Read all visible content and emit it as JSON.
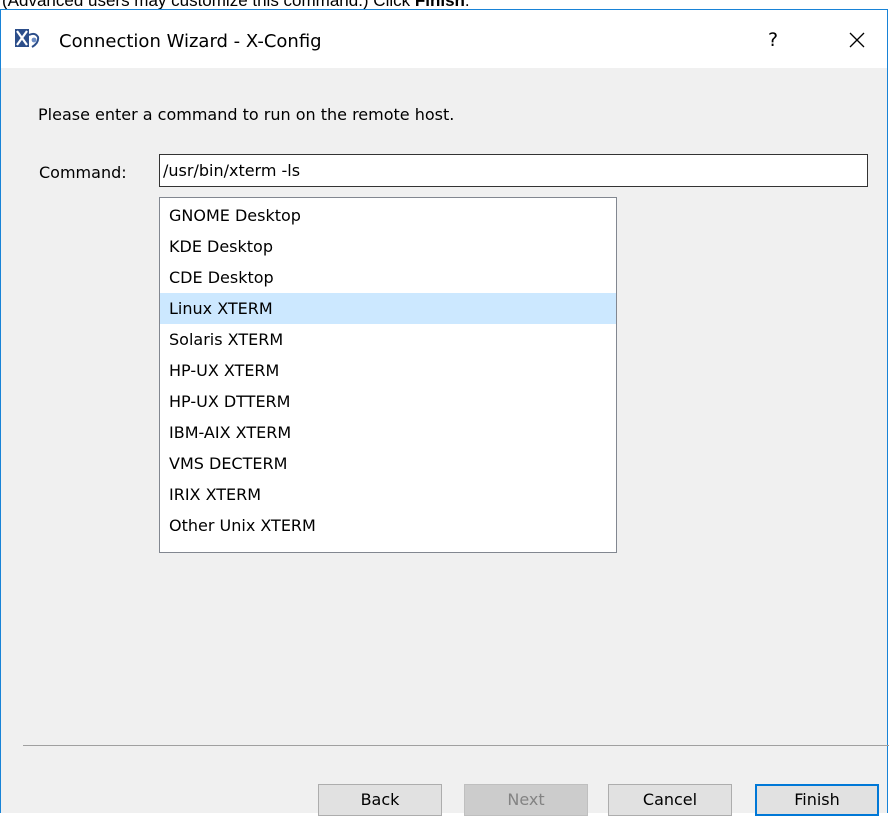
{
  "caption": {
    "text_before": "(Advanced users may customize this command.) Click ",
    "bold": "Finish",
    "text_after": "."
  },
  "window": {
    "title": "Connection Wizard - X-Config",
    "help_label": "?",
    "app_icon": "x-config-icon",
    "close_icon": "close-icon",
    "accent": "#1883d7"
  },
  "content": {
    "prompt": "Please enter a command to run on the remote host.",
    "command_label": "Command:",
    "command_value": "/usr/bin/xterm -ls"
  },
  "list": {
    "selected_index": 3,
    "selected_color": "#cce8ff",
    "items": [
      "GNOME Desktop",
      "KDE Desktop",
      "CDE Desktop",
      "Linux XTERM",
      "Solaris XTERM",
      "HP-UX XTERM",
      "HP-UX DTTERM",
      "IBM-AIX XTERM",
      "VMS DECTERM",
      "IRIX XTERM",
      "Other Unix XTERM"
    ]
  },
  "buttons": {
    "back": "Back",
    "next": "Next",
    "next_enabled": false,
    "cancel": "Cancel",
    "finish": "Finish",
    "default_color": "#0078d7"
  }
}
